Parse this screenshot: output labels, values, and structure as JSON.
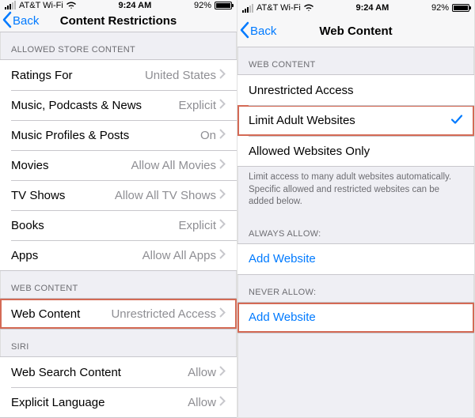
{
  "status": {
    "carrier": "AT&T Wi-Fi",
    "time": "9:24 AM",
    "battery": "92%"
  },
  "left": {
    "back": "Back",
    "title": "Content Restrictions",
    "sections": {
      "store_header": "ALLOWED STORE CONTENT",
      "web_header": "WEB CONTENT",
      "siri_header": "SIRI"
    },
    "rows": {
      "ratings_label": "Ratings For",
      "ratings_value": "United States",
      "music_label": "Music, Podcasts & News",
      "music_value": "Explicit",
      "profiles_label": "Music Profiles & Posts",
      "profiles_value": "On",
      "movies_label": "Movies",
      "movies_value": "Allow All Movies",
      "tv_label": "TV Shows",
      "tv_value": "Allow All TV Shows",
      "books_label": "Books",
      "books_value": "Explicit",
      "apps_label": "Apps",
      "apps_value": "Allow All Apps",
      "webcontent_label": "Web Content",
      "webcontent_value": "Unrestricted Access",
      "websearch_label": "Web Search Content",
      "websearch_value": "Allow",
      "explicitlang_label": "Explicit Language",
      "explicitlang_value": "Allow"
    }
  },
  "right": {
    "back": "Back",
    "title": "Web Content",
    "sections": {
      "web_header": "WEB CONTENT",
      "web_footer": "Limit access to many adult websites automatically. Specific allowed and restricted websites can be added below.",
      "always_header": "ALWAYS ALLOW:",
      "never_header": "NEVER ALLOW:"
    },
    "rows": {
      "unrestricted": "Unrestricted Access",
      "limitadult": "Limit Adult Websites",
      "allowedonly": "Allowed Websites Only",
      "addwebsite": "Add Website"
    }
  }
}
